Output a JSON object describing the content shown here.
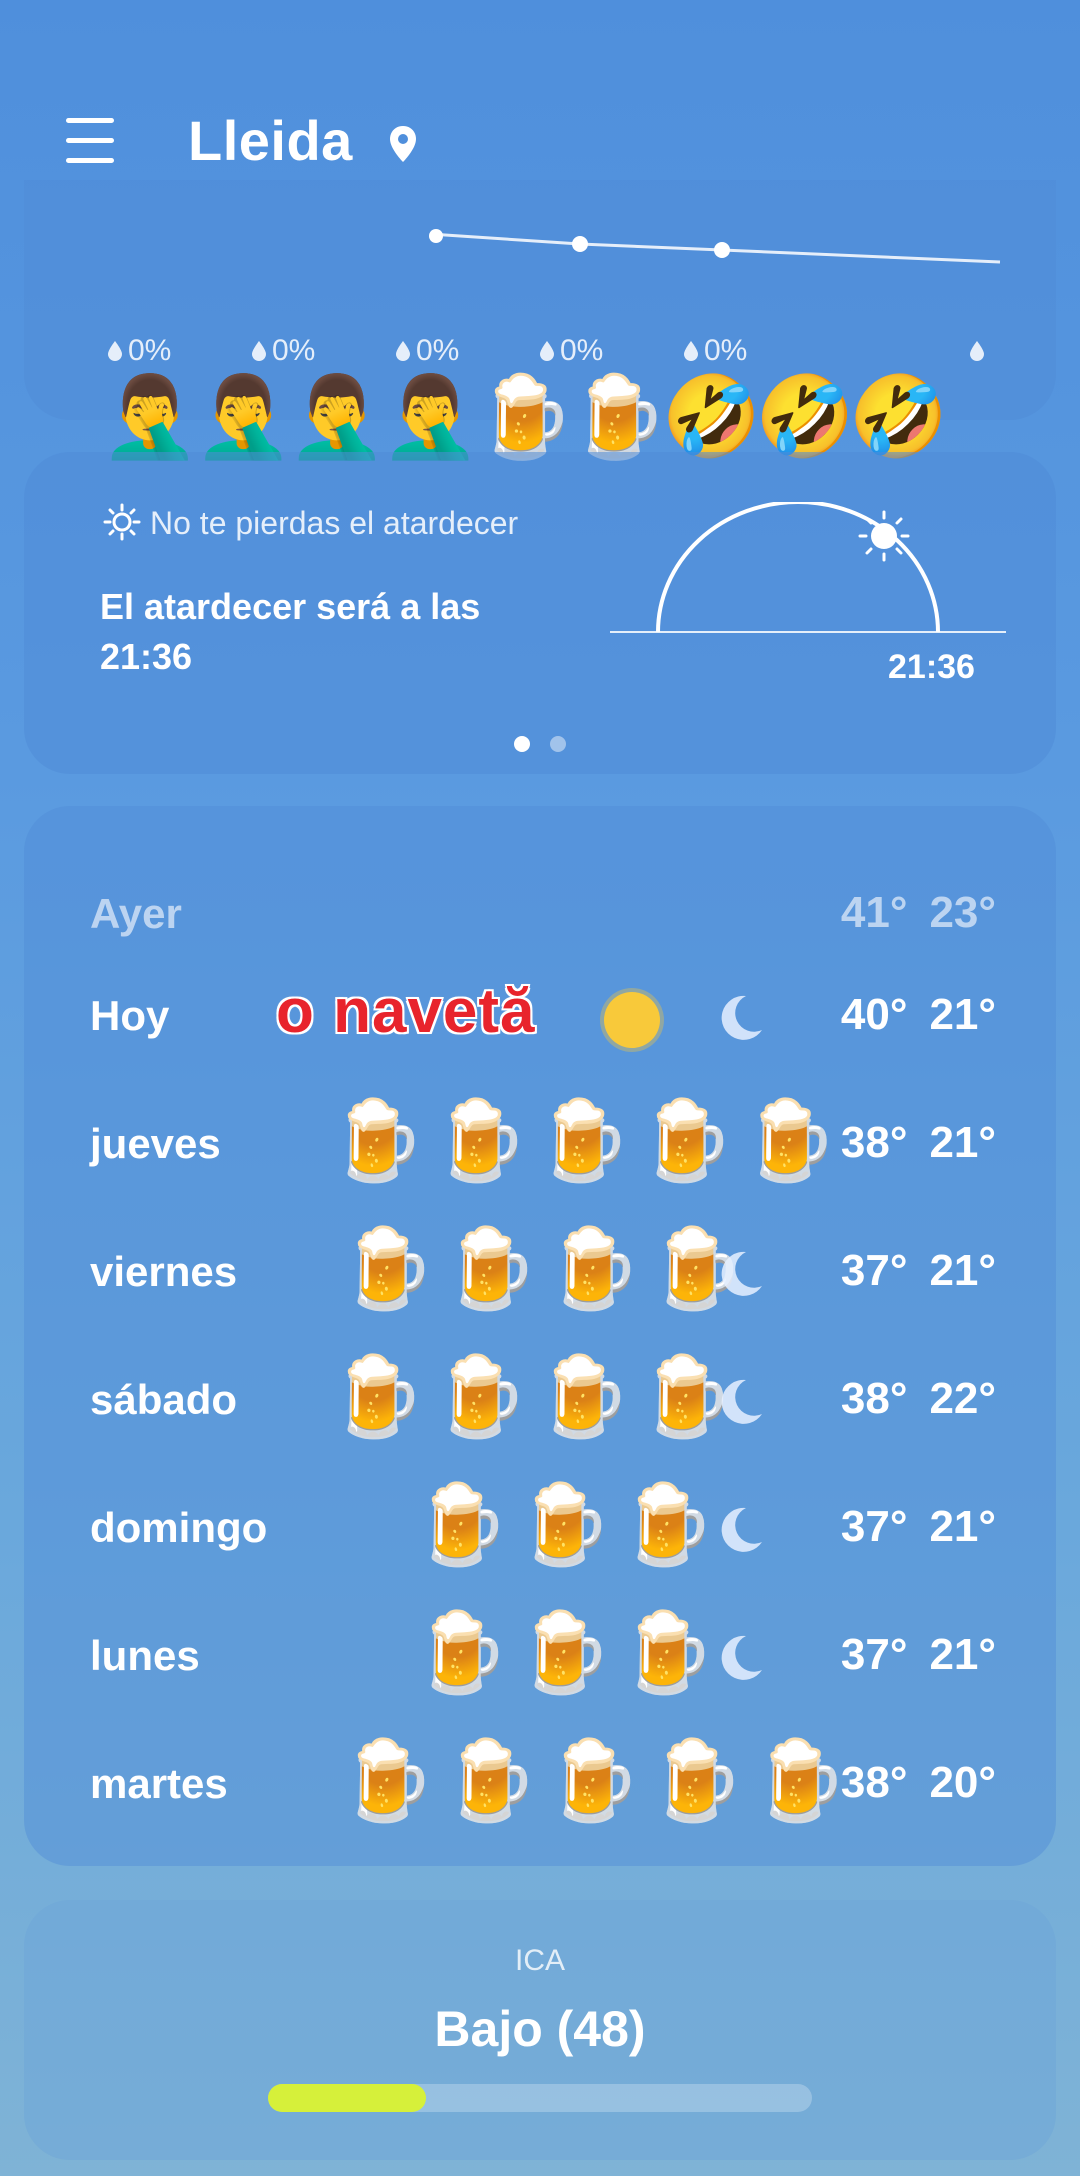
{
  "header": {
    "city": "Lleida",
    "icons": [
      "menu-icon",
      "location-pin-icon"
    ]
  },
  "hourly": {
    "precip": [
      "0%",
      "0%",
      "0%",
      "0%",
      "0%"
    ],
    "emoji_overlay": "🤦‍♂️🤦‍♂️🤦‍♂️🤦‍♂️🍺🍺🤣🤣🤣"
  },
  "sunset": {
    "label": "No te pierdas el atardecer",
    "text": "El atardecer será a las 21:36",
    "time": "21:36",
    "page_indicator": {
      "pages": 2,
      "current": 1
    }
  },
  "forecast": {
    "rows": [
      {
        "day": "Ayer",
        "high": "41°",
        "low": "23°",
        "faded": true,
        "beers": "",
        "moon": false
      },
      {
        "day": "Hoy",
        "high": "40°",
        "low": "21°",
        "faded": false,
        "beers": "",
        "moon": true,
        "sun": true
      },
      {
        "day": "jueves",
        "high": "38°",
        "low": "21°",
        "faded": false,
        "beers": "🍺🍺🍺🍺🍺",
        "moon": false
      },
      {
        "day": "viernes",
        "high": "37°",
        "low": "21°",
        "faded": false,
        "beers": "🍺🍺🍺🍺",
        "moon": true
      },
      {
        "day": "sábado",
        "high": "38°",
        "low": "22°",
        "faded": false,
        "beers": "🍺🍺🍺🍺",
        "moon": true
      },
      {
        "day": "domingo",
        "high": "37°",
        "low": "21°",
        "faded": false,
        "beers": "🍺🍺🍺",
        "moon": true
      },
      {
        "day": "lunes",
        "high": "37°",
        "low": "21°",
        "faded": false,
        "beers": "🍺🍺🍺",
        "moon": true
      },
      {
        "day": "martes",
        "high": "38°",
        "low": "20°",
        "faded": false,
        "beers": "🍺🍺🍺🍺🍺",
        "moon": false
      }
    ],
    "caption_overlay": "o navetă"
  },
  "ica": {
    "label": "ICA",
    "value": "Bajo (48)",
    "level": 0.29,
    "bar_color": "#d6f03a"
  }
}
